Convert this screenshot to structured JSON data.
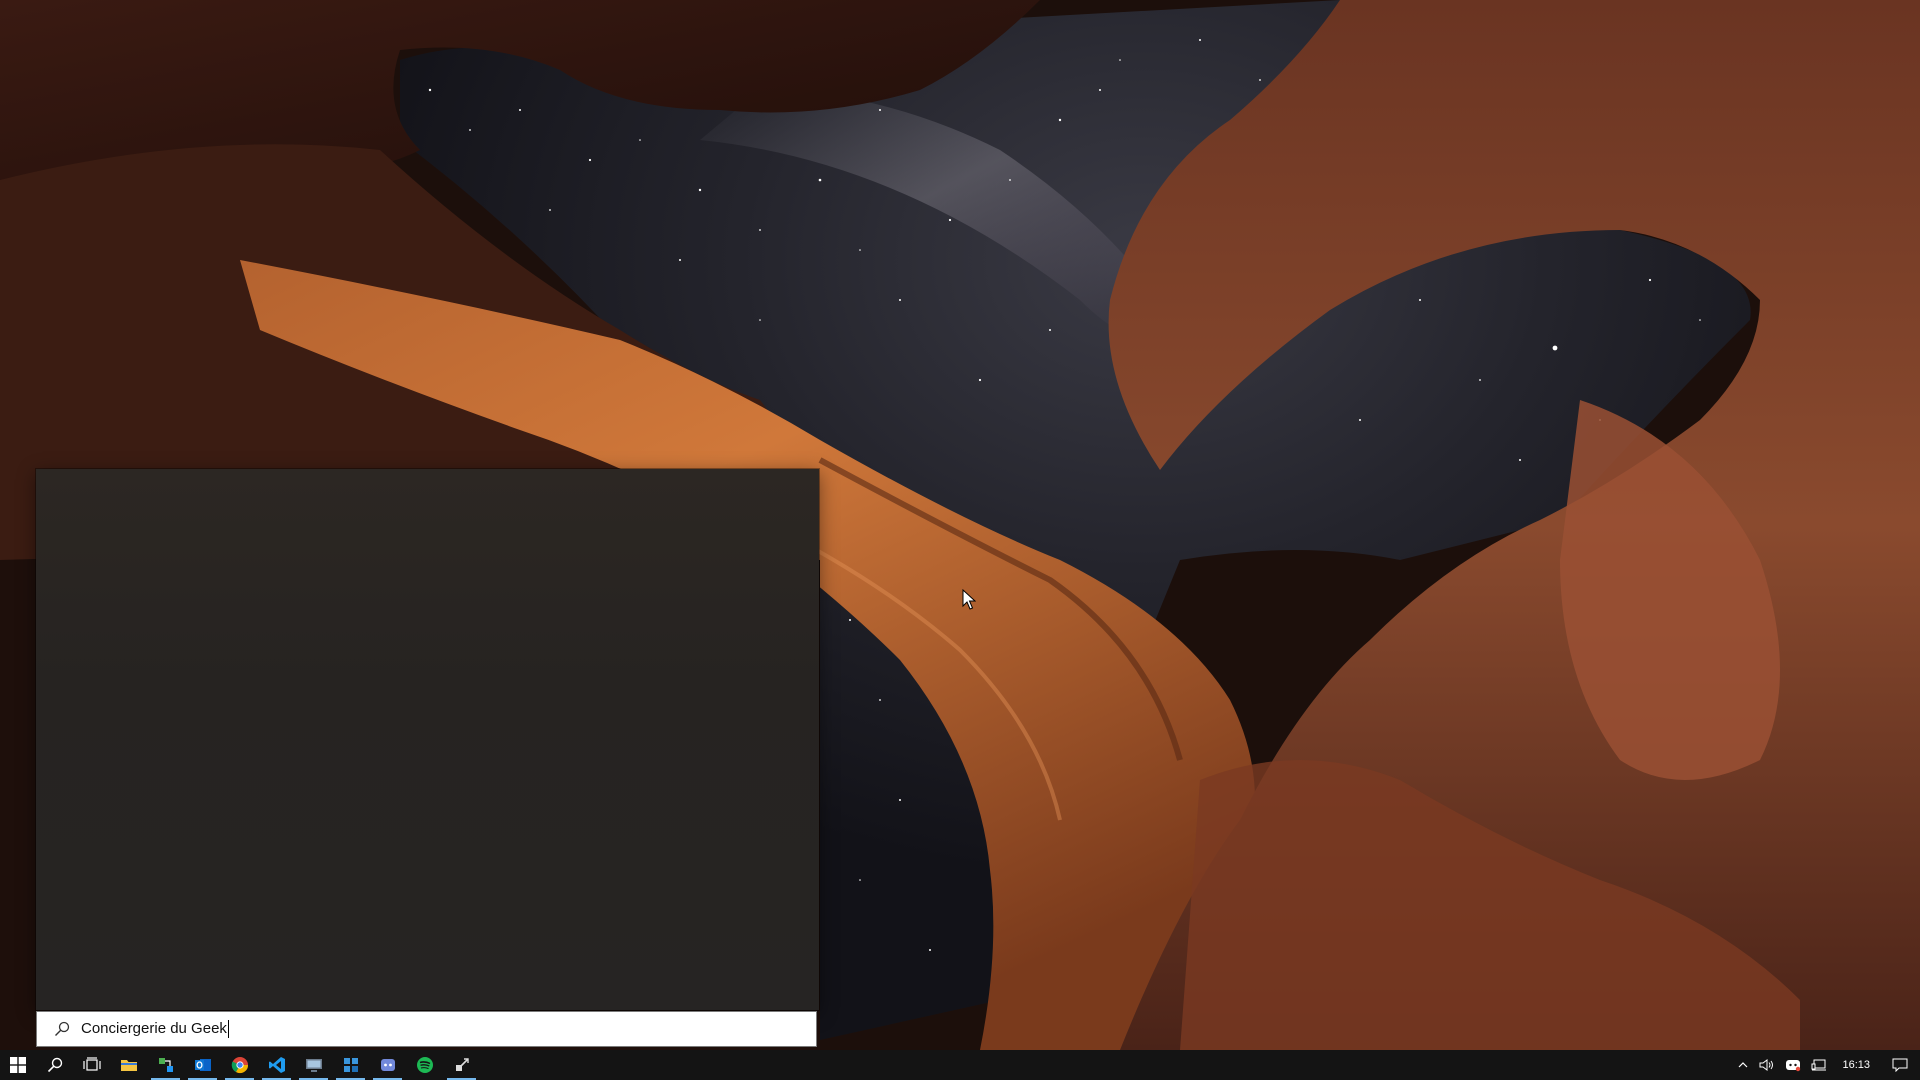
{
  "search": {
    "query": "Conciergerie du Geek"
  },
  "taskbar": {
    "apps": [
      {
        "name": "start-button",
        "icon": "windows-logo-icon"
      },
      {
        "name": "search-button",
        "icon": "search-icon"
      },
      {
        "name": "task-view-button",
        "icon": "task-view-icon"
      },
      {
        "name": "file-explorer-button",
        "icon": "folder-icon"
      },
      {
        "name": "network-tool-button",
        "icon": "network-tool-icon"
      },
      {
        "name": "outlook-button",
        "icon": "outlook-icon"
      },
      {
        "name": "chrome-button",
        "icon": "chrome-icon"
      },
      {
        "name": "vscode-button",
        "icon": "vscode-icon"
      },
      {
        "name": "remote-desktop-button",
        "icon": "remote-desktop-icon"
      },
      {
        "name": "app-button",
        "icon": "app-grid-icon"
      },
      {
        "name": "discord-button",
        "icon": "discord-icon"
      },
      {
        "name": "spotify-button",
        "icon": "spotify-icon"
      },
      {
        "name": "tool-button",
        "icon": "tool-icon"
      }
    ],
    "clock": "16:13",
    "accent_color": "#76b9ed"
  }
}
